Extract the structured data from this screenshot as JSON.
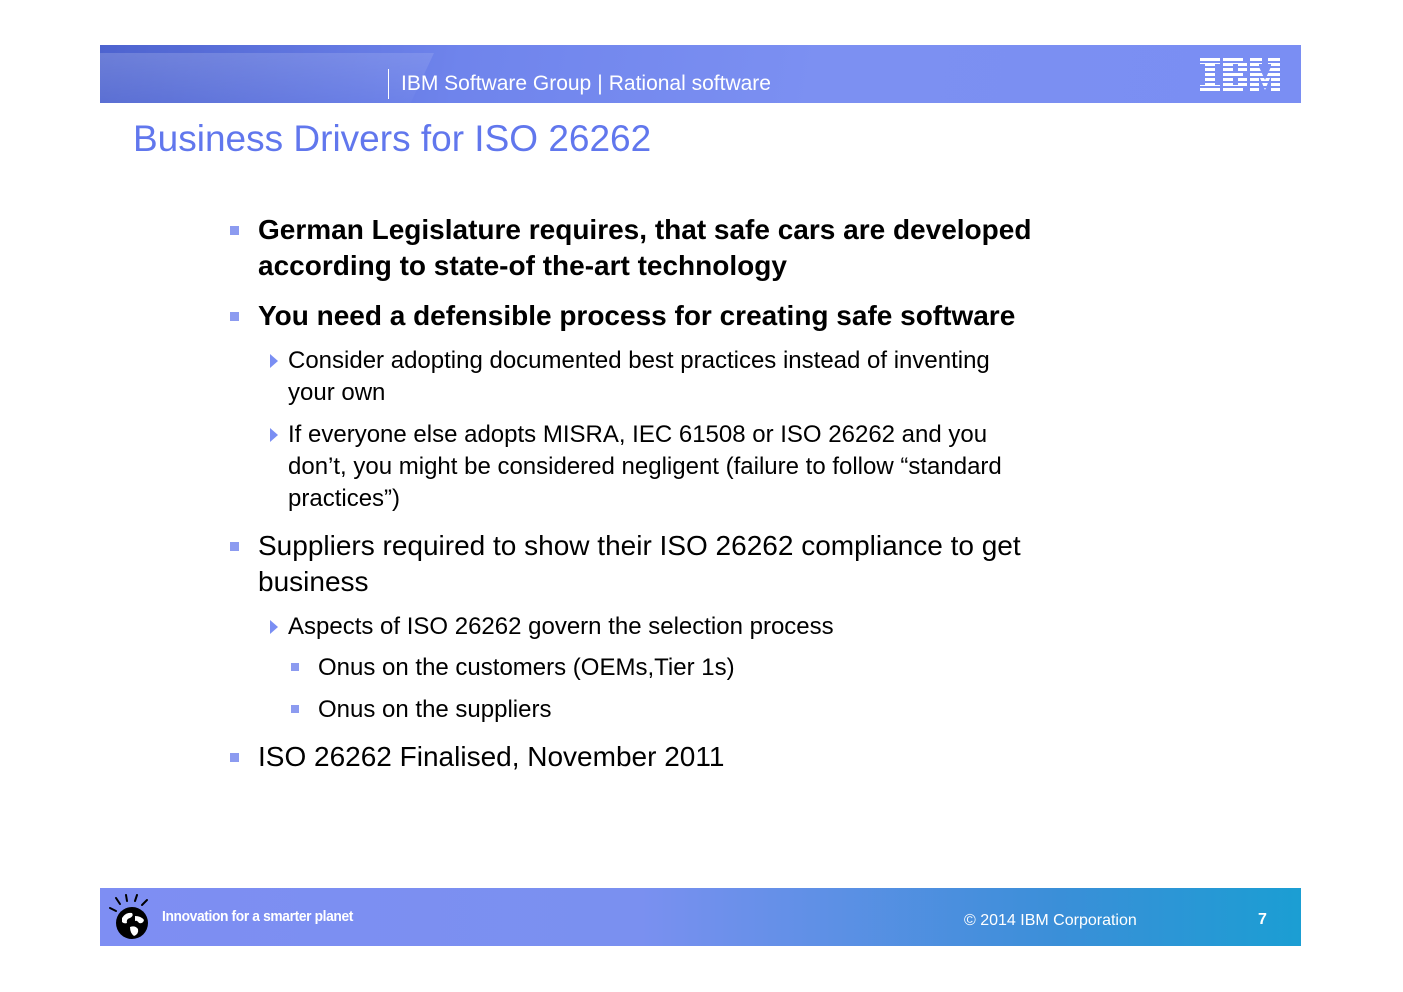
{
  "header": {
    "group": "IBM Software Group",
    "division": "Rational software",
    "separator": "|",
    "logo_text": "IBM"
  },
  "slide": {
    "title": "Business Drivers for ISO 26262",
    "bullets": [
      {
        "line1": "German Legislature requires, that safe cars are developed",
        "line2": "according to state-of the-art technology"
      },
      {
        "line1": "You need a defensible process for creating safe software",
        "subs": [
          {
            "line1": "Consider adopting documented best practices instead of inventing",
            "line2": "your own"
          },
          {
            "line1": " If everyone else adopts MISRA, IEC 61508 or ISO 26262 and you",
            "line2": "don’t, you might be considered negligent (failure to follow “standard",
            "line3": "practices”)"
          }
        ]
      },
      {
        "line1": "Suppliers required to show their ISO 26262 compliance to get",
        "line2": "business",
        "subs": [
          {
            "line1": "Aspects of ISO 26262 govern the selection process",
            "subs": [
              {
                "text": "Onus on the customers (OEMs,Tier 1s)"
              },
              {
                "text": "Onus on the suppliers"
              }
            ]
          }
        ]
      },
      {
        "line1": "ISO 26262 Finalised, November 2011"
      }
    ]
  },
  "footer": {
    "tagline": "Innovation for a smarter planet",
    "copyright": "© 2014 IBM Corporation",
    "page_number": "7"
  },
  "colors": {
    "title": "#6177ed",
    "band": "#7a8ef3",
    "bullet": "#8c9bf0"
  },
  "icons": [
    "ibm-logo-icon",
    "smarter-planet-globe-icon",
    "square-bullet-icon",
    "triangle-bullet-icon"
  ]
}
